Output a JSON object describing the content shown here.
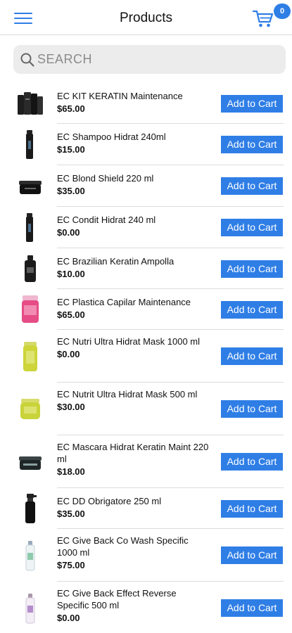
{
  "header": {
    "title": "Products",
    "menu_icon": "hamburger-menu-icon",
    "cart_icon": "shopping-cart-icon",
    "cart_count": "0",
    "accent_color": "#2f7ee6"
  },
  "search": {
    "placeholder": "SEARCH",
    "value": "",
    "icon": "search-icon"
  },
  "products": [
    {
      "name": "EC KIT KERATIN Maintenance",
      "price": "$65.00",
      "button": "Add to Cart",
      "thumb": "kit-bottles"
    },
    {
      "name": "EC Shampoo Hidrat 240ml",
      "price": "$15.00",
      "button": "Add to Cart",
      "thumb": "tall-bottle"
    },
    {
      "name": "EC Blond Shield 220 ml",
      "price": "$35.00",
      "button": "Add to Cart",
      "thumb": "black-jar"
    },
    {
      "name": "EC Condit Hidrat 240 ml",
      "price": "$0.00",
      "button": "Add to Cart",
      "thumb": "tall-bottle"
    },
    {
      "name": "EC Brazilian Keratin Ampolla",
      "price": "$10.00",
      "button": "Add to Cart",
      "thumb": "small-bottle"
    },
    {
      "name": "EC Plastica Capilar Maintenance",
      "price": "$65.00",
      "button": "Add to Cart",
      "thumb": "pink-jar"
    },
    {
      "name": "EC Nutri Ultra Hidrat Mask 1000 ml",
      "price": "$0.00",
      "button": "Add to Cart",
      "thumb": "yellow-jar-tall"
    },
    {
      "name": "EC Nutrit Ultra Hidrat Mask 500 ml",
      "price": "$30.00",
      "button": "Add to Cart",
      "thumb": "yellow-jar"
    },
    {
      "name": "EC Mascara Hidrat Keratin Maint 220 ml",
      "price": "$18.00",
      "button": "Add to Cart",
      "thumb": "dark-jar"
    },
    {
      "name": "EC DD Obrigatore 250 ml",
      "price": "$35.00",
      "button": "Add to Cart",
      "thumb": "spray-bottle"
    },
    {
      "name": "EC Give Back Co Wash Specific 1000 ml",
      "price": "$75.00",
      "button": "Add to Cart",
      "thumb": "clear-bottle"
    },
    {
      "name": "EC Give Back Effect Reverse Specific 500 ml",
      "price": "$0.00",
      "button": "Add to Cart",
      "thumb": "clear-bottle-purple"
    }
  ]
}
